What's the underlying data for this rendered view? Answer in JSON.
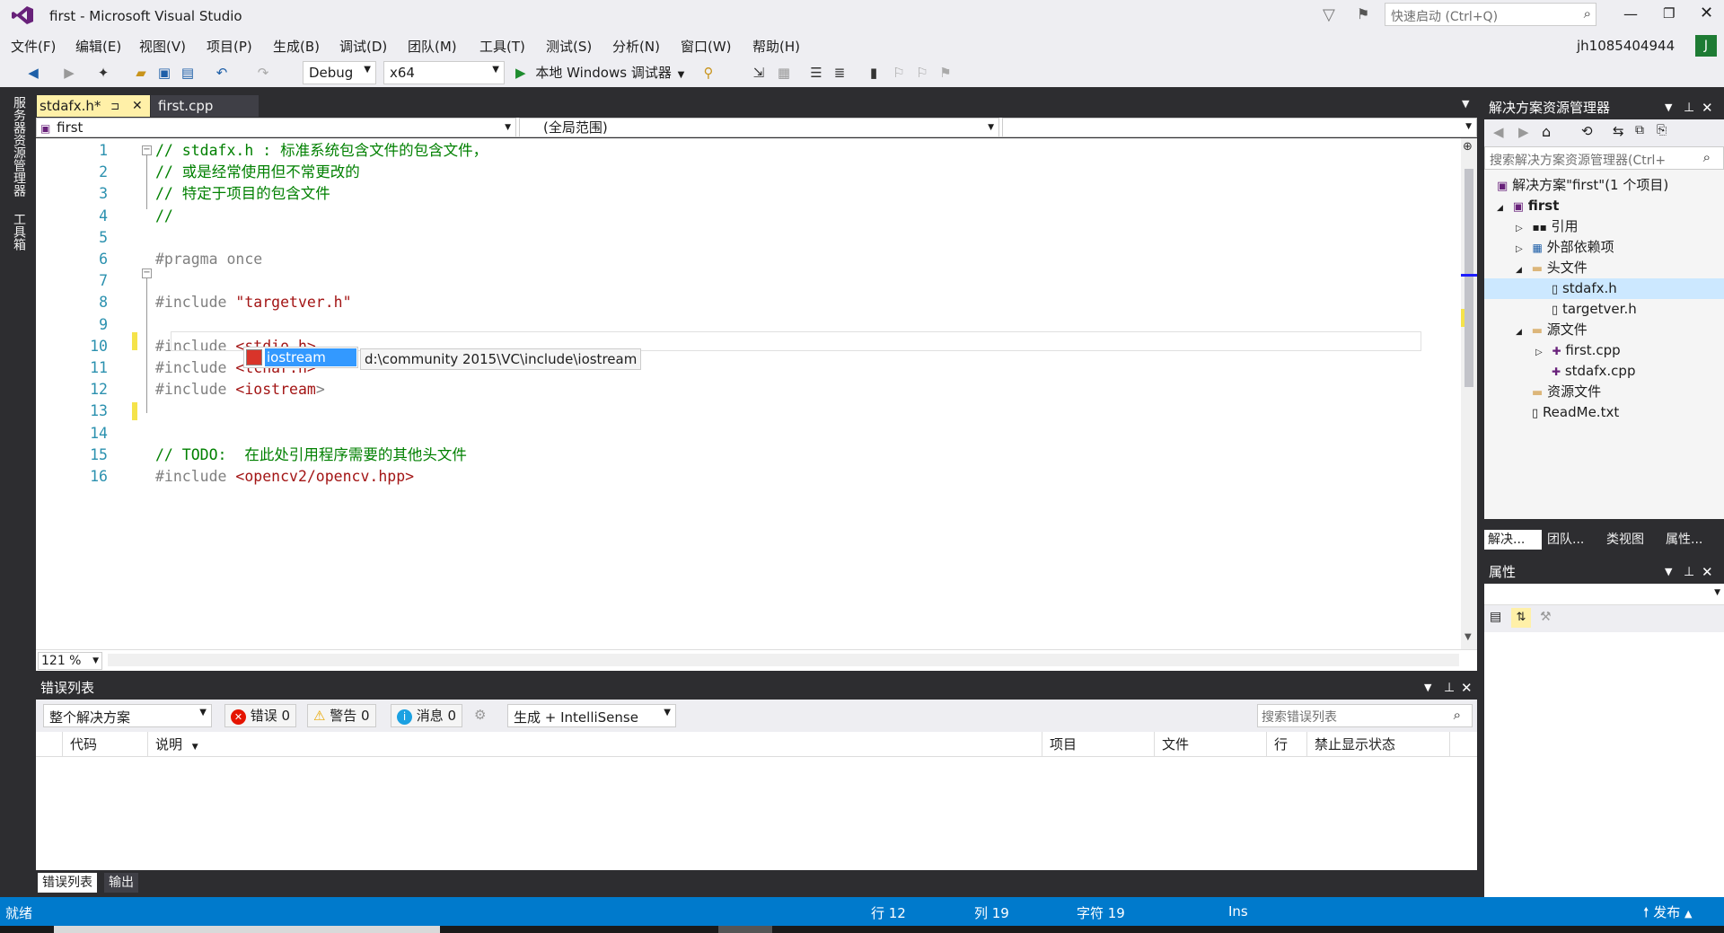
{
  "title": {
    "text": "first - Microsoft Visual Studio",
    "quick_launch_placeholder": "快速启动 (Ctrl+Q)",
    "user": "jh1085404944",
    "avatar_letter": "J"
  },
  "menu": [
    "文件(F)",
    "编辑(E)",
    "视图(V)",
    "项目(P)",
    "生成(B)",
    "调试(D)",
    "团队(M)",
    "工具(T)",
    "测试(S)",
    "分析(N)",
    "窗口(W)",
    "帮助(H)"
  ],
  "toolbar": {
    "config": "Debug",
    "platform": "x64",
    "run_label": "本地 Windows 调试器"
  },
  "left_strip": {
    "server_explorer": "服务器资源管理器",
    "toolbox": "工具箱"
  },
  "tabs": [
    {
      "label": "stdafx.h*",
      "active": true,
      "pin": "⊐"
    },
    {
      "label": "first.cpp",
      "active": false
    }
  ],
  "nav": {
    "project": "first",
    "scope": "(全局范围)"
  },
  "code": [
    {
      "n": "1",
      "tokens": [
        {
          "t": "// stdafx.h : 标准系统包含文件的包含文件，",
          "c": "cmt"
        }
      ]
    },
    {
      "n": "2",
      "tokens": [
        {
          "t": "// 或是经常使用但不常更改的",
          "c": "cmt"
        }
      ]
    },
    {
      "n": "3",
      "tokens": [
        {
          "t": "// 特定于项目的包含文件",
          "c": "cmt"
        }
      ]
    },
    {
      "n": "4",
      "tokens": [
        {
          "t": "//",
          "c": "cmt"
        }
      ]
    },
    {
      "n": "5",
      "tokens": []
    },
    {
      "n": "6",
      "tokens": [
        {
          "t": "#pragma once",
          "c": "pp"
        }
      ]
    },
    {
      "n": "7",
      "tokens": []
    },
    {
      "n": "8",
      "tokens": [
        {
          "t": "#include ",
          "c": "pp"
        },
        {
          "t": "\"targetver.h\"",
          "c": "str"
        }
      ]
    },
    {
      "n": "9",
      "tokens": []
    },
    {
      "n": "10",
      "tokens": [
        {
          "t": "#include ",
          "c": "pp"
        },
        {
          "t": "<stdio.h>",
          "c": "str"
        }
      ]
    },
    {
      "n": "11",
      "tokens": [
        {
          "t": "#include ",
          "c": "pp"
        },
        {
          "t": "<tchar.h>",
          "c": "str"
        }
      ]
    },
    {
      "n": "12",
      "tokens": [
        {
          "t": "#include ",
          "c": "pp"
        },
        {
          "t": "<iostream",
          "c": "str"
        },
        {
          "t": ">",
          "c": "pp"
        }
      ]
    },
    {
      "n": "13",
      "tokens": []
    },
    {
      "n": "14",
      "tokens": []
    },
    {
      "n": "15",
      "tokens": [
        {
          "t": "// TODO:  在此处引用程序需要的其他头文件",
          "c": "cmt"
        }
      ]
    },
    {
      "n": "16",
      "tokens": [
        {
          "t": "#include ",
          "c": "pp"
        },
        {
          "t": "<opencv2/opencv.hpp>",
          "c": "str"
        }
      ]
    }
  ],
  "intellisense": {
    "item": "iostream",
    "path": "d:\\community 2015\\VC\\include\\iostream"
  },
  "zoom": "121 %",
  "error_list": {
    "title": "错误列表",
    "scope": "整个解决方案",
    "errors": "错误 0",
    "warnings": "警告 0",
    "messages": "消息 0",
    "build_filter": "生成 + IntelliSense",
    "search_placeholder": "搜索错误列表",
    "columns": [
      "代码",
      "说明",
      "项目",
      "文件",
      "行",
      "禁止显示状态"
    ],
    "bottom_tabs": [
      "错误列表",
      "输出"
    ]
  },
  "solution_explorer": {
    "title": "解决方案资源管理器",
    "search_placeholder": "搜索解决方案资源管理器(Ctrl+",
    "items": [
      "解决方案\"first\"(1 个项目)",
      "first",
      "引用",
      "外部依赖项",
      "头文件",
      "stdafx.h",
      "targetver.h",
      "源文件",
      "first.cpp",
      "stdafx.cpp",
      "资源文件",
      "ReadMe.txt"
    ],
    "bottom_tabs": [
      "解决...",
      "团队...",
      "类视图",
      "属性..."
    ]
  },
  "properties": {
    "title": "属性"
  },
  "status": {
    "ready": "就绪",
    "line": "行 12",
    "col": "列 19",
    "char": "字符 19",
    "ins": "Ins",
    "publish": "发布"
  }
}
